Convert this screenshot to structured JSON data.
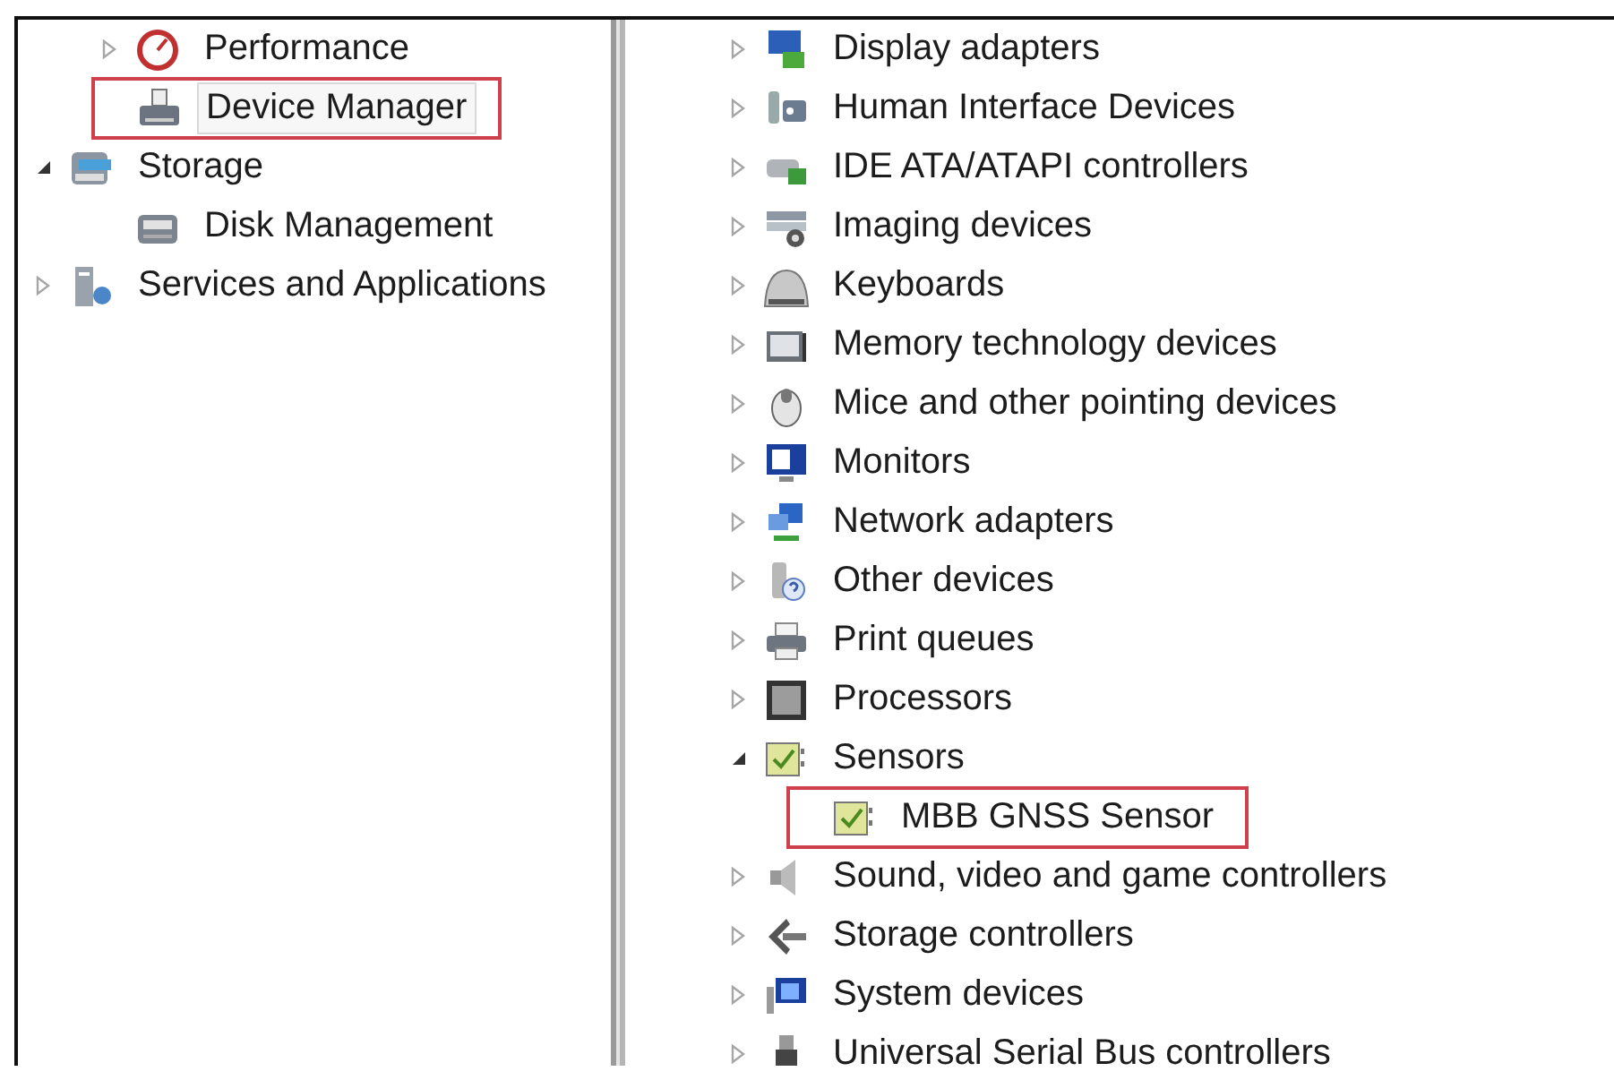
{
  "left_tree": {
    "continued_children": [
      {
        "label": "Performance",
        "kind": "branch",
        "expanded": false,
        "selected": false,
        "highlighted": false
      },
      {
        "label": "Device Manager",
        "kind": "leaf",
        "selected": true,
        "highlighted": true
      }
    ],
    "items": [
      {
        "label": "Storage",
        "kind": "branch",
        "expanded": true,
        "selected": false,
        "highlighted": false,
        "children": [
          {
            "label": "Disk Management",
            "kind": "leaf",
            "selected": false,
            "highlighted": false
          }
        ]
      },
      {
        "label": "Services and Applications",
        "kind": "branch",
        "expanded": false,
        "selected": false,
        "highlighted": false
      }
    ]
  },
  "device_tree": {
    "continued_children": [
      {
        "label": "Display adapters",
        "kind": "branch",
        "expanded": false,
        "highlighted": false
      },
      {
        "label": "Human Interface Devices",
        "kind": "branch",
        "expanded": false,
        "highlighted": false
      },
      {
        "label": "IDE ATA/ATAPI controllers",
        "kind": "branch",
        "expanded": false,
        "highlighted": false
      },
      {
        "label": "Imaging devices",
        "kind": "branch",
        "expanded": false,
        "highlighted": false
      },
      {
        "label": "Keyboards",
        "kind": "branch",
        "expanded": false,
        "highlighted": false
      },
      {
        "label": "Memory technology devices",
        "kind": "branch",
        "expanded": false,
        "highlighted": false
      },
      {
        "label": "Mice and other pointing devices",
        "kind": "branch",
        "expanded": false,
        "highlighted": false
      },
      {
        "label": "Monitors",
        "kind": "branch",
        "expanded": false,
        "highlighted": false
      },
      {
        "label": "Network adapters",
        "kind": "branch",
        "expanded": false,
        "highlighted": false
      },
      {
        "label": "Other devices",
        "kind": "branch",
        "expanded": false,
        "highlighted": false
      },
      {
        "label": "Print queues",
        "kind": "branch",
        "expanded": false,
        "highlighted": false
      },
      {
        "label": "Processors",
        "kind": "branch",
        "expanded": false,
        "highlighted": false
      },
      {
        "label": "Sensors",
        "kind": "branch",
        "expanded": true,
        "highlighted": false,
        "children": [
          {
            "label": "MBB GNSS Sensor",
            "kind": "leaf",
            "highlighted": true
          }
        ]
      },
      {
        "label": "Sound, video and game controllers",
        "kind": "branch",
        "expanded": false,
        "highlighted": false
      },
      {
        "label": "Storage controllers",
        "kind": "branch",
        "expanded": false,
        "highlighted": false
      },
      {
        "label": "System devices",
        "kind": "branch",
        "expanded": false,
        "highlighted": false
      },
      {
        "label": "Universal Serial Bus controllers",
        "kind": "branch",
        "expanded": false,
        "highlighted": false
      }
    ]
  }
}
